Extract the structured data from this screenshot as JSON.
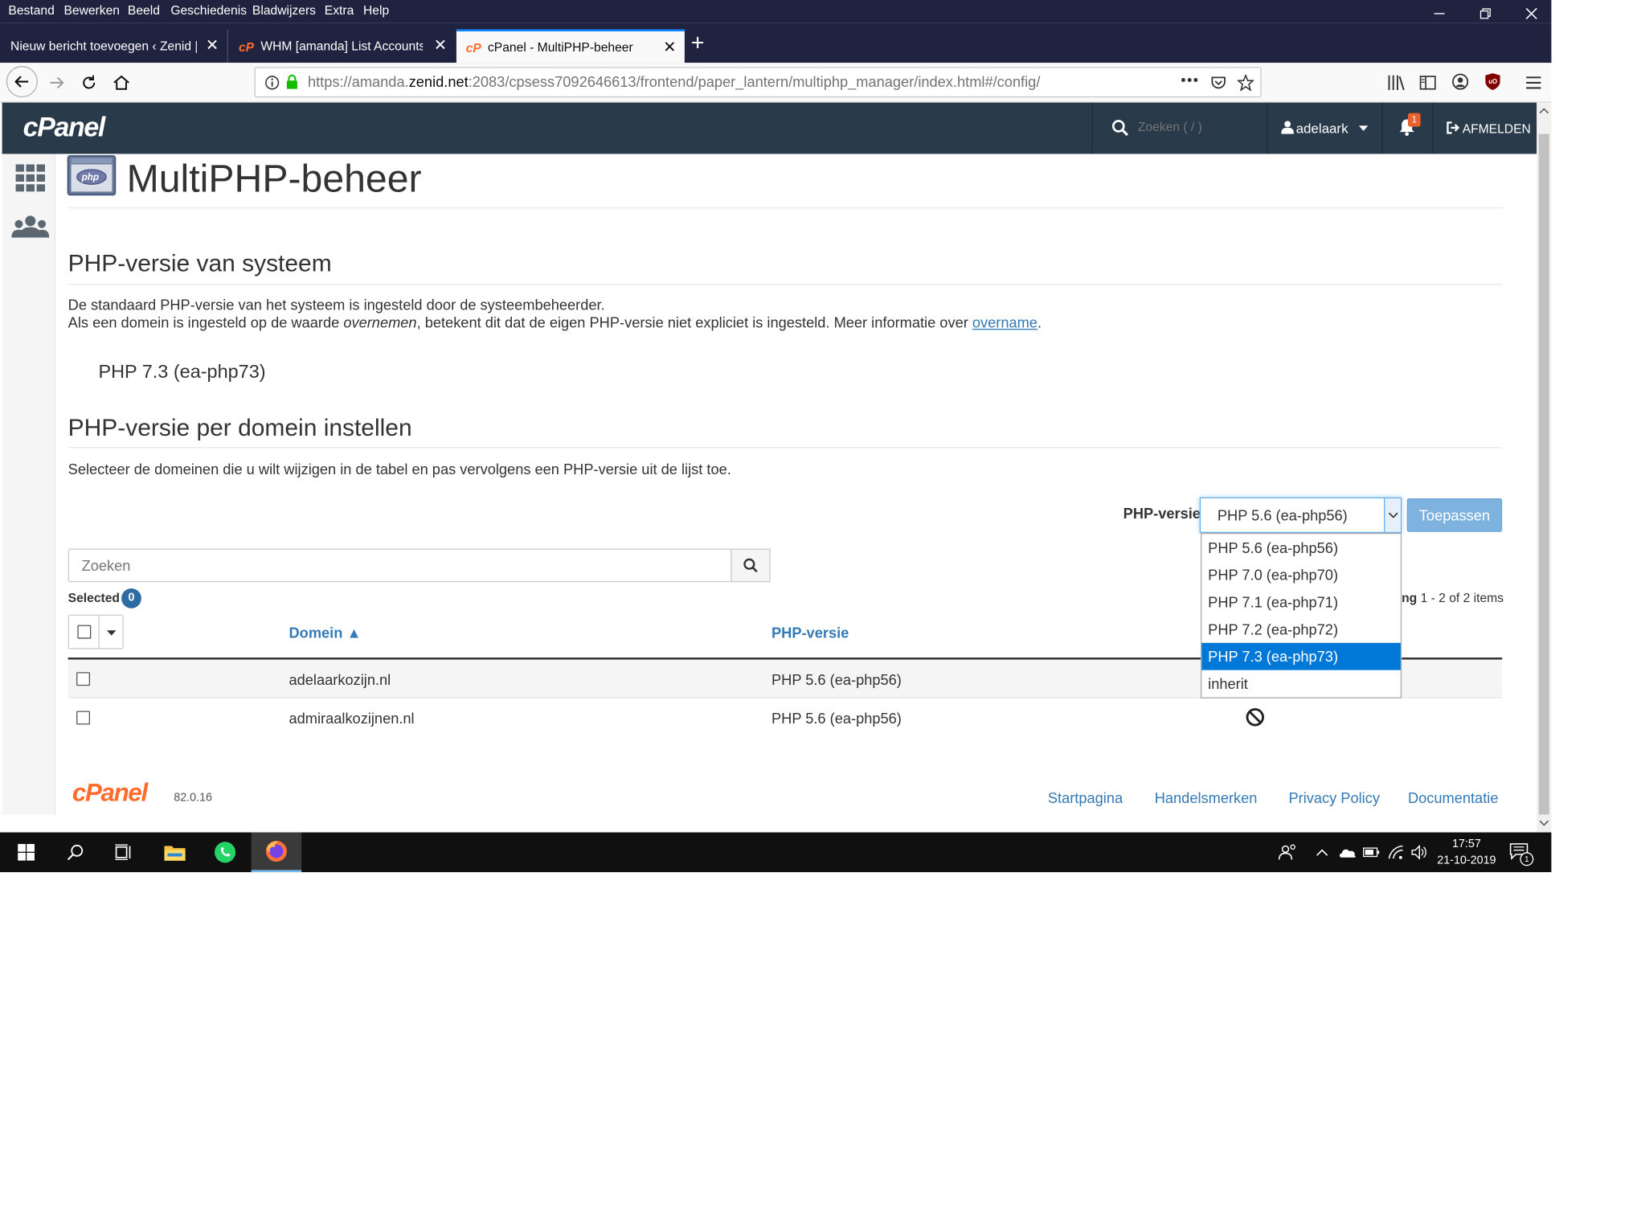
{
  "menubar": {
    "items": [
      "Bestand",
      "Bewerken",
      "Beeld",
      "Geschiedenis",
      "Bladwijzers",
      "Extra",
      "Help"
    ],
    "accesskeys": [
      "B",
      "w",
      "l",
      "G",
      "l",
      "x",
      "H"
    ]
  },
  "tabs": [
    {
      "label": "Nieuw bericht toevoegen ‹ Zenid |",
      "close": "✕"
    },
    {
      "label": "WHM [amanda] List Accounts -",
      "close": "✕"
    },
    {
      "label": "cPanel - MultiPHP-beheer",
      "close": "✕"
    }
  ],
  "newtab": "+",
  "url": {
    "prefix": "https://amanda.",
    "domain": "zenid.net",
    "suffix": ":2083/cpsess7092646613/frontend/paper_lantern/multiphp_manager/index.html#/config/",
    "more": "•••"
  },
  "cpanel": {
    "logo": "cPanel",
    "search_placeholder": "Zoeken ( / )",
    "user": "adelaark",
    "notifications": "1",
    "logout": "AFMELDEN"
  },
  "page": {
    "title": "MultiPHP-beheer",
    "icon_label": "php",
    "system_heading": "PHP-versie van systeem",
    "system_line1": "De standaard PHP-versie van het systeem is ingesteld door de systeembeheerder.",
    "system_line2_pre": "Als een domein is ingesteld op de waarde ",
    "system_line2_em": "overnemen",
    "system_line2_mid": ", betekent dit dat de eigen PHP-versie niet expliciet is ingesteld. Meer informatie over ",
    "system_line2_link": "overname",
    "system_line2_end": ".",
    "system_version": "PHP 7.3 (ea-php73)",
    "domain_heading": "PHP-versie per domein instellen",
    "domain_desc": "Selecteer de domeinen die u wilt wijzigen in de tabel en pas vervolgens een PHP-versie uit de lijst toe.",
    "php_label": "PHP-versie",
    "php_selected": "PHP 5.6 (ea-php56)",
    "apply": "Toepassen",
    "options": [
      "PHP 5.6 (ea-php56)",
      "PHP 7.0 (ea-php70)",
      "PHP 7.1 (ea-php71)",
      "PHP 7.2 (ea-php72)",
      "PHP 7.3 (ea-php73)",
      "inherit"
    ],
    "highlighted_option": "PHP 7.3 (ea-php73)",
    "table_search_placeholder": "Zoeken",
    "selected_label": "Selected",
    "selected_count": "0",
    "paging_pre": "ng",
    "paging": "1 - 2 of 2 items",
    "col_domain": "Domein ▲",
    "col_php": "PHP-versie",
    "rows": [
      {
        "domain": "adelaarkozijn.nl",
        "php": "PHP 5.6 (ea-php56)"
      },
      {
        "domain": "admiraalkozijnen.nl",
        "php": "PHP 5.6 (ea-php56)"
      }
    ]
  },
  "footer": {
    "logo": "cPanel",
    "version": "82.0.16",
    "links": [
      "Startpagina",
      "Handelsmerken",
      "Privacy Policy",
      "Documentatie"
    ]
  },
  "taskbar": {
    "time": "17:57",
    "date": "21-10-2019",
    "notif_count": "1"
  },
  "colors": {
    "cpanel_header": "#293a4a",
    "link": "#337ab7",
    "brand_orange": "#ff6c2c",
    "select_highlight": "#0078d7"
  }
}
